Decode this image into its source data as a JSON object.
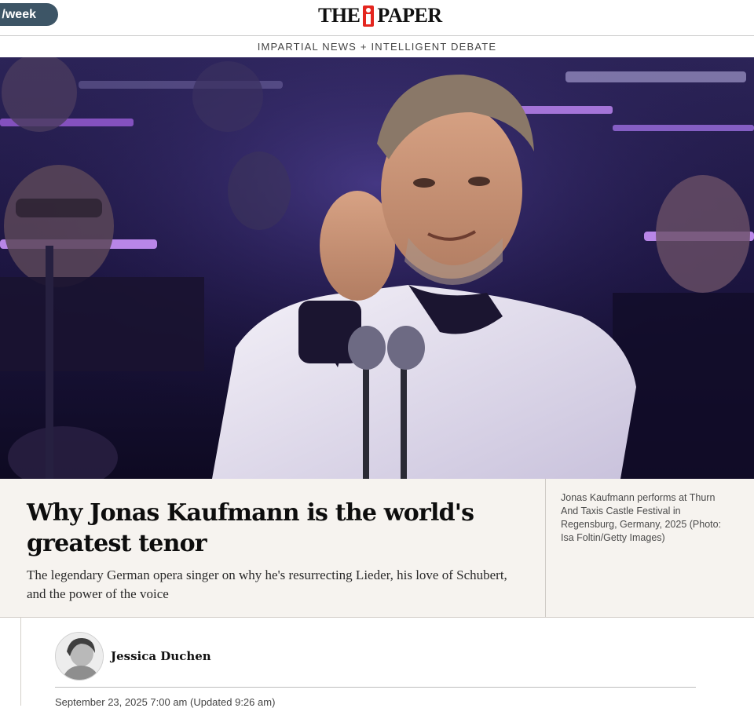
{
  "header": {
    "subscribe_partial": "/week",
    "logo_left": "THE",
    "logo_right": "PAPER",
    "tagline": "IMPARTIAL NEWS + INTELLIGENT DEBATE"
  },
  "article": {
    "headline": "Why Jonas Kaufmann is the world's greatest tenor",
    "standfirst": "The legendary German opera singer on why he's resurrecting Lieder, his love of Schubert, and the power of the voice",
    "caption": "Jonas Kaufmann performs at Thurn And Taxis Castle Festival in Regensburg, Germany, 2025 (Photo: Isa Foltin/Getty Images)",
    "author": "Jessica Duchen",
    "dateline": "September 23, 2025 7:00 am (Updated 9:26 am)"
  },
  "colors": {
    "accent_red": "#e4261f",
    "pill": "#3d5566",
    "headline_bg": "#f6f3ef"
  }
}
